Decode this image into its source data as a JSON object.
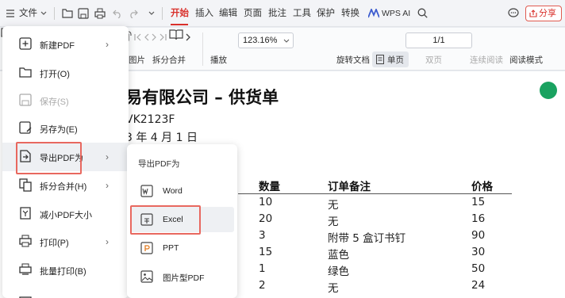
{
  "menubar": {
    "file_label": "文件",
    "tabs": [
      "开始",
      "插入",
      "编辑",
      "页面",
      "批注",
      "工具",
      "保护",
      "转换"
    ],
    "wps_ai_label": "WPS AI",
    "share_label": "分享"
  },
  "ribbon": {
    "image_label": "图片",
    "split_merge_label": "拆分合并",
    "play_label": "播放",
    "zoom_value": "123.16%",
    "page_value": "1/1",
    "rotate_label": "旋转文档",
    "single_page_label": "单页",
    "double_page_label": "双页",
    "continuous_label": "连续阅读",
    "read_mode_label": "阅读模式"
  },
  "document": {
    "title": "易有限公司 – 供货单",
    "line1": "VK2123F",
    "line2": "3 年 4 月 1 日",
    "headers": [
      "数量",
      "订单备注",
      "价格"
    ],
    "rows": [
      [
        "10",
        "无",
        "15"
      ],
      [
        "20",
        "无",
        "16"
      ],
      [
        "3",
        "附带 5 盒订书钉",
        "90"
      ],
      [
        "15",
        "蓝色",
        "30"
      ],
      [
        "1",
        "绿色",
        "50"
      ],
      [
        "2",
        "无",
        "24"
      ]
    ]
  },
  "file_menu": {
    "items": [
      {
        "label": "新建PDF",
        "icon": "new-pdf-icon",
        "has_arrow": true
      },
      {
        "label": "打开(O)",
        "icon": "open-folder-icon",
        "has_arrow": false
      },
      {
        "label": "保存(S)",
        "icon": "save-icon",
        "has_arrow": false,
        "disabled": true
      },
      {
        "label": "另存为(E)",
        "icon": "save-as-icon",
        "has_arrow": false
      },
      {
        "label": "导出PDF为",
        "icon": "export-icon",
        "has_arrow": true
      },
      {
        "label": "拆分合并(H)",
        "icon": "split-merge-icon",
        "has_arrow": true
      },
      {
        "label": "减小PDF大小",
        "icon": "compress-icon",
        "has_arrow": false
      },
      {
        "label": "打印(P)",
        "icon": "print-icon",
        "has_arrow": true
      },
      {
        "label": "批量打印(B)",
        "icon": "batch-print-icon",
        "has_arrow": false
      }
    ]
  },
  "export_submenu": {
    "title": "导出PDF为",
    "items": [
      {
        "label": "Word",
        "icon": "word-icon"
      },
      {
        "label": "Excel",
        "icon": "excel-icon"
      },
      {
        "label": "PPT",
        "icon": "ppt-icon"
      },
      {
        "label": "图片型PDF",
        "icon": "image-pdf-icon"
      }
    ]
  },
  "colors": {
    "accent_red": "#d9302b",
    "highlight_outline": "#e8685f",
    "green_fab": "#1aa260"
  }
}
